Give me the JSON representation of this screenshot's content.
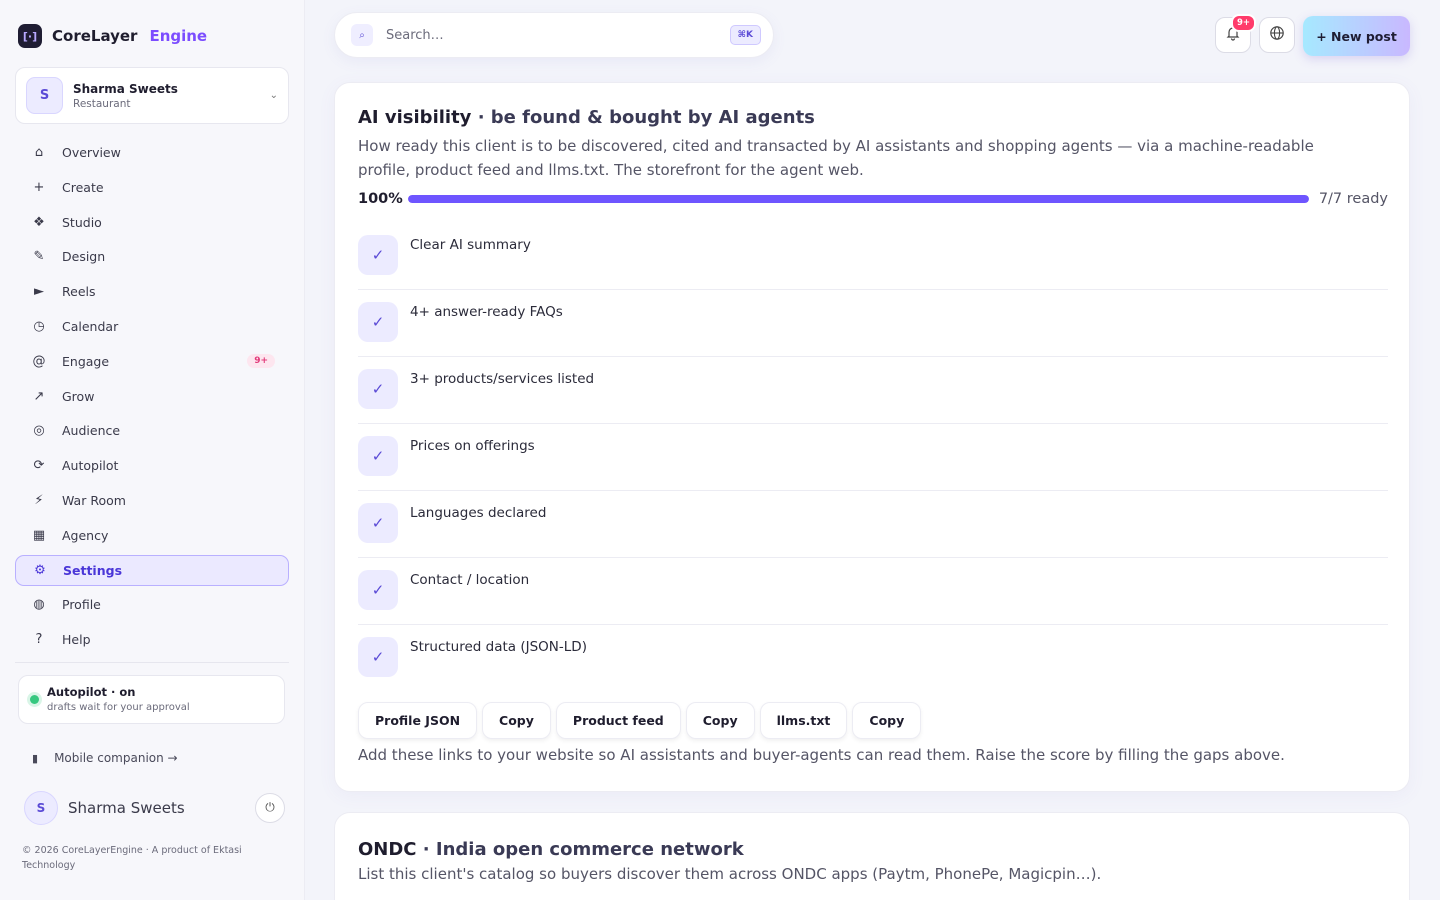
{
  "brand": {
    "name": "CoreLayer",
    "accent": "Engine",
    "logo": "[·]"
  },
  "account": {
    "initial": "S",
    "name": "Sharma Sweets",
    "type": "Restaurant",
    "chevron": "⌄"
  },
  "nav": [
    {
      "icon": "⌂",
      "label": "Overview"
    },
    {
      "icon": "+",
      "label": "Create"
    },
    {
      "icon": "❖",
      "label": "Studio"
    },
    {
      "icon": "✎",
      "label": "Design"
    },
    {
      "icon": "►",
      "label": "Reels"
    },
    {
      "icon": "◷",
      "label": "Calendar"
    },
    {
      "icon": "@",
      "label": "Engage",
      "badge": "9+"
    },
    {
      "icon": "↗",
      "label": "Grow"
    },
    {
      "icon": "◎",
      "label": "Audience"
    },
    {
      "icon": "⟳",
      "label": "Autopilot"
    },
    {
      "icon": "⚡",
      "label": "War Room"
    },
    {
      "icon": "▦",
      "label": "Agency"
    },
    {
      "icon": "⚙",
      "label": "Settings",
      "active": true
    },
    {
      "icon": "◍",
      "label": "Profile"
    },
    {
      "icon": "?",
      "label": "Help"
    }
  ],
  "autopilot": {
    "title": "Autopilot · on",
    "subtitle": "drafts wait for your approval"
  },
  "mobile": {
    "icon": "▮",
    "label": "Mobile companion →"
  },
  "user": {
    "initial": "S",
    "name": "Sharma Sweets",
    "power": "⏻"
  },
  "footer": "© 2026 CoreLayerEngine · A product of Ektasi Technology",
  "search": {
    "icon": "⌕",
    "placeholder": "Search…",
    "shortcut": "⌘K"
  },
  "topbar": {
    "bell": "♫",
    "notif_count": "9+",
    "globe": "⊕",
    "new_post": "+ New post"
  },
  "ai_card": {
    "title": "AI visibility",
    "title_sub": " · be found & bought by AI agents",
    "description": "How ready this client is to be discovered, cited and transacted by AI assistants and shopping agents — via a machine-readable profile, product feed and llms.txt. The storefront for the agent web.",
    "progress_label": "100%",
    "progress_value": 1.0,
    "ready": "7/7 ready",
    "checklist": [
      "Clear AI summary",
      "4+ answer-ready FAQs",
      "3+ products/services listed",
      "Prices on offerings",
      "Languages declared",
      "Contact / location",
      "Structured data (JSON-LD)"
    ],
    "check_mark": "✓",
    "buttons": [
      "Profile JSON",
      "Copy",
      "Product feed",
      "Copy",
      "llms.txt",
      "Copy"
    ],
    "help": "Add these links to your website so AI assistants and buyer-agents can read them. Raise the score by filling the gaps above."
  },
  "ondc_card": {
    "title": "ONDC",
    "title_sub": " · India open commerce network",
    "description": "List this client's catalog so buyers discover them across ONDC apps (Paytm, PhonePe, Magicpin…)."
  },
  "colors": {
    "accent": "#6e55ff",
    "brand_accent": "#7c4dff",
    "active_bg": "#ebe9ff",
    "badge": "#ff3b6b"
  }
}
